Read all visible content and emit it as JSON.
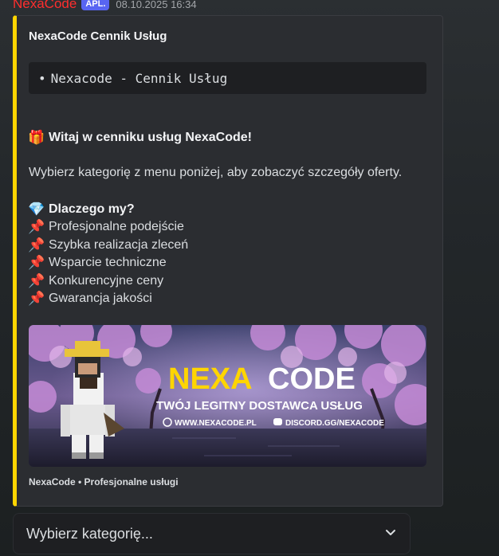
{
  "message": {
    "author": "NexaCode",
    "badge": "APL.",
    "timestamp": "08.10.2025 16:34"
  },
  "embed": {
    "title": "NexaCode Cennik Usług",
    "code_bullet": "•",
    "code_text": "Nexacode - Cennik Usług",
    "welcome_text": "Witaj w cenniku usług NexaCode!",
    "description": "Wybierz kategorię z menu poniżej, aby zobaczyć szczegóły oferty.",
    "why_title": "Dlaczego my?",
    "why_items": [
      "Profesjonalne podejście",
      "Szybka realizacja zleceń",
      "Wsparcie techniczne",
      "Konkurencyjne ceny",
      "Gwarancja jakości"
    ],
    "banner": {
      "brand_first": "NEXA",
      "brand_second": "CODE",
      "tagline": "TWÓJ LEGITNY DOSTAWCA USŁUG",
      "website": "WWW.NEXACODE.PL",
      "discord": "DISCORD.GG/NEXACODE"
    },
    "footer": "NexaCode • Profesjonalne usługi",
    "accent_color": "#ffd500"
  },
  "select_menu": {
    "placeholder": "Wybierz kategorię..."
  },
  "icons": {
    "gift": "gift-icon",
    "gem": "gem-icon",
    "pin": "pushpin-icon",
    "chevron": "chevron-down-icon"
  }
}
